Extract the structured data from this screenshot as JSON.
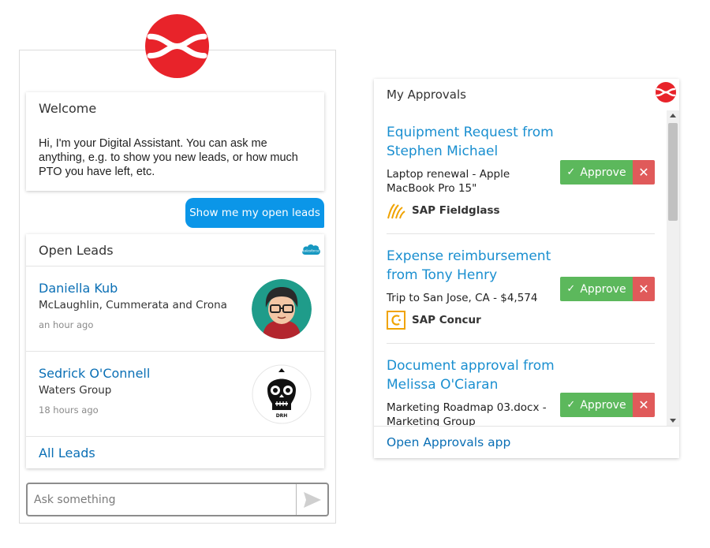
{
  "chat": {
    "welcome_title": "Welcome",
    "welcome_text": "Hi, I'm your Digital Assistant. You can ask me anything, e.g. to show you new leads, or how much PTO you have left, etc.",
    "user_message": "Show me my open leads",
    "leads_title": "Open Leads",
    "leads": [
      {
        "name": "Daniella Kub",
        "company": "McLaughlin, Cummerata and Crona",
        "time": "an hour ago"
      },
      {
        "name": "Sedrick O'Connell",
        "company": "Waters Group",
        "time": "18 hours ago"
      }
    ],
    "all_leads_label": "All Leads",
    "input_placeholder": "Ask something",
    "input_value": ""
  },
  "approvals": {
    "title": "My Approvals",
    "approve_label": "Approve",
    "items": [
      {
        "title": "Equipment Request from Stephen Michael",
        "description": "Laptop renewal - Apple MacBook Pro 15\"",
        "source": "SAP Fieldglass",
        "source_icon": "fieldglass-icon"
      },
      {
        "title": "Expense reimbursement from Tony Henry",
        "description": "Trip to San Jose, CA - $4,574",
        "source": "SAP Concur",
        "source_icon": "concur-icon"
      },
      {
        "title": "Document approval from Melissa O'Ciaran",
        "description": "Marketing Roadmap 03.docx - Marketing Group",
        "source": "",
        "source_icon": ""
      }
    ],
    "footer_link": "Open Approvals app"
  },
  "colors": {
    "brand_red": "#e8232a",
    "link_blue": "#0a6fb5",
    "bubble_blue": "#0b96e8",
    "approve_green": "#5cb85c",
    "reject_red": "#e05a5a"
  }
}
